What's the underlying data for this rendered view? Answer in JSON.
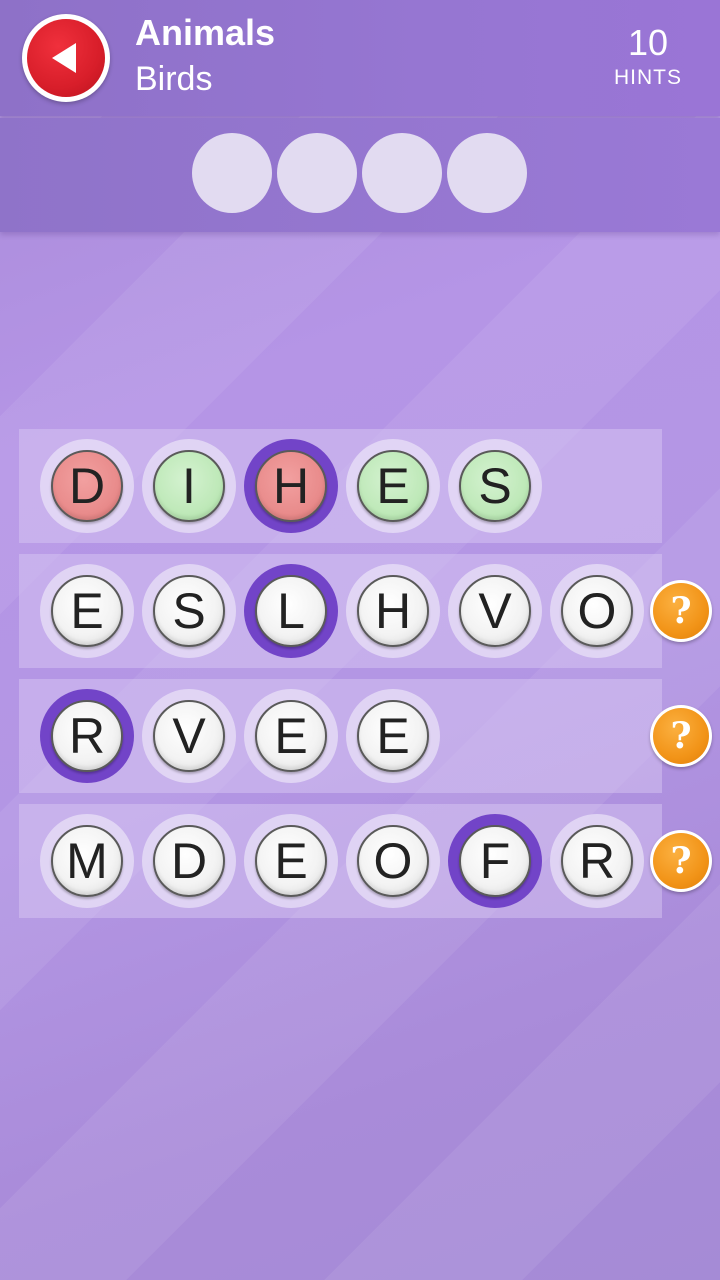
{
  "header": {
    "category": "Animals",
    "subcategory": "Birds",
    "hints_count": "10",
    "hints_label": "HINTS"
  },
  "answer": {
    "slots": 4
  },
  "hint_symbol": "?",
  "rows": [
    {
      "tiles": [
        {
          "letter": "D",
          "state": "red",
          "selected": false
        },
        {
          "letter": "I",
          "state": "green",
          "selected": false
        },
        {
          "letter": "H",
          "state": "red",
          "selected": true
        },
        {
          "letter": "E",
          "state": "green",
          "selected": false
        },
        {
          "letter": "S",
          "state": "green",
          "selected": false
        }
      ],
      "hint": false
    },
    {
      "tiles": [
        {
          "letter": "E",
          "state": "normal",
          "selected": false
        },
        {
          "letter": "S",
          "state": "normal",
          "selected": false
        },
        {
          "letter": "L",
          "state": "normal",
          "selected": true
        },
        {
          "letter": "H",
          "state": "normal",
          "selected": false
        },
        {
          "letter": "V",
          "state": "normal",
          "selected": false
        },
        {
          "letter": "O",
          "state": "normal",
          "selected": false
        }
      ],
      "hint": true
    },
    {
      "tiles": [
        {
          "letter": "R",
          "state": "normal",
          "selected": true
        },
        {
          "letter": "V",
          "state": "normal",
          "selected": false
        },
        {
          "letter": "E",
          "state": "normal",
          "selected": false
        },
        {
          "letter": "E",
          "state": "normal",
          "selected": false
        }
      ],
      "hint": true
    },
    {
      "tiles": [
        {
          "letter": "M",
          "state": "normal",
          "selected": false
        },
        {
          "letter": "D",
          "state": "normal",
          "selected": false
        },
        {
          "letter": "E",
          "state": "normal",
          "selected": false
        },
        {
          "letter": "O",
          "state": "normal",
          "selected": false
        },
        {
          "letter": "F",
          "state": "normal",
          "selected": true
        },
        {
          "letter": "R",
          "state": "normal",
          "selected": false
        }
      ],
      "hint": true
    }
  ],
  "colors": {
    "back_button": "#d81e2a",
    "hint_button": "#f29418",
    "selected_ring": "#7244c8",
    "wrong_tile": "#e98c8c",
    "correct_tile": "#bfe9b9"
  }
}
